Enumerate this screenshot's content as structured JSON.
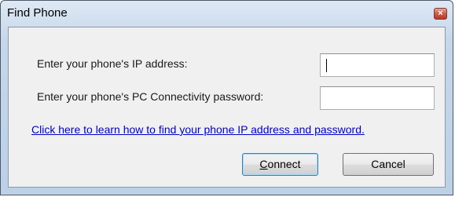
{
  "window": {
    "title": "Find Phone",
    "close_glyph": "×"
  },
  "form": {
    "ip_label": "Enter your phone's IP address:",
    "ip_value": "",
    "password_label": "Enter your phone's PC Connectivity password:",
    "password_value": ""
  },
  "help_link": "Click here to learn how to find your phone IP address and password.",
  "buttons": {
    "connect_mnemonic": "C",
    "connect_rest": "onnect",
    "cancel": "Cancel"
  },
  "colors": {
    "link": "#0000cc",
    "close_button": "#c84a34",
    "default_button_border": "#3c7fb1"
  },
  "icons": {
    "close": "close-icon"
  }
}
